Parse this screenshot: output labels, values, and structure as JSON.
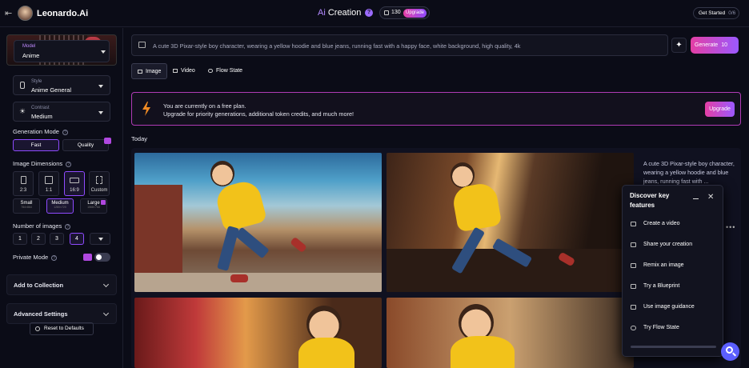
{
  "header": {
    "brand_name": "Leonardo",
    "brand_suffix": ".Ai",
    "title_ai": "Ai",
    "title_rest": " Creation",
    "help": "?",
    "tokens": "130",
    "upgrade_badge": "Upgrade",
    "get_started": "Get Started",
    "get_started_progress": "0/6"
  },
  "sidebar": {
    "model_label": "Model",
    "model_value": "Anime",
    "style_label": "Style",
    "style_value": "Anime General",
    "contrast_label": "Contrast",
    "contrast_value": "Medium",
    "generation_mode_title": "Generation Mode",
    "mode_fast": "Fast",
    "mode_quality": "Quality",
    "image_dimensions_title": "Image Dimensions",
    "dimensions": [
      {
        "label": "2:3"
      },
      {
        "label": "1:1"
      },
      {
        "label": "16:9"
      },
      {
        "label": "Custom"
      }
    ],
    "sizes": [
      {
        "label": "Small",
        "res": "784×864"
      },
      {
        "label": "Medium",
        "res": "1280×720"
      },
      {
        "label": "Large",
        "res": "1568×768"
      }
    ],
    "number_of_images_title": "Number of images",
    "numbers": [
      "1",
      "2",
      "3",
      "4"
    ],
    "private_mode_title": "Private Mode",
    "add_to_collection": "Add to Collection",
    "advanced_settings": "Advanced Settings",
    "reset": "Reset to Defaults"
  },
  "prompt": {
    "text": "A cute 3D Pixar-style boy character, wearing a yellow hoodie and blue jeans, running fast with a happy face, white background, high quality, 4k",
    "generate_label": "Generate",
    "generate_cost": "10"
  },
  "tabs": [
    {
      "label": "Image",
      "active": true
    },
    {
      "label": "Video",
      "active": false
    },
    {
      "label": "Flow State",
      "active": false
    }
  ],
  "plan_banner": {
    "line1": "You are currently on a free plan.",
    "line2": "Upgrade for priority generations, additional token credits, and much more!",
    "button": "Upgrade"
  },
  "feed": {
    "section_label": "Today",
    "description": "A cute 3D Pixar-style boy character, wearing a yellow hoodie and blue jeans, running fast with ..."
  },
  "discover": {
    "title": "Discover key features",
    "items": [
      {
        "label": "Create a video",
        "icon": "film-icon"
      },
      {
        "label": "Share your creation",
        "icon": "share-icon"
      },
      {
        "label": "Remix an image",
        "icon": "remix-icon"
      },
      {
        "label": "Try a Blueprint",
        "icon": "blueprint-icon"
      },
      {
        "label": "Use image guidance",
        "icon": "guidance-icon"
      },
      {
        "label": "Try Flow State",
        "icon": "link-icon"
      }
    ]
  },
  "colors": {
    "accent_pink": "#e43fa4",
    "accent_purple": "#9b59ff",
    "background": "#0b0c17"
  }
}
